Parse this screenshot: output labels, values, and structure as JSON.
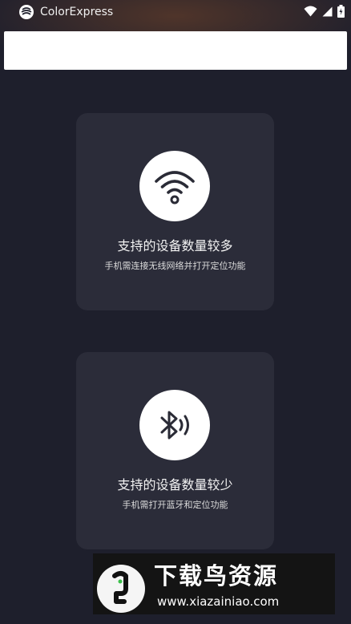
{
  "status_bar": {
    "app_name": "ColorExpress",
    "icons": [
      "app-logo-icon",
      "wifi-signal-icon",
      "cell-signal-icon",
      "battery-icon"
    ]
  },
  "search": {
    "value": "",
    "placeholder": ""
  },
  "cards": [
    {
      "icon": "wifi-icon",
      "title": "支持的设备数量较多",
      "subtitle": "手机需连接无线网络并打开定位功能"
    },
    {
      "icon": "bluetooth-icon",
      "title": "支持的设备数量较少",
      "subtitle": "手机需打开蓝牙和定位功能"
    }
  ],
  "watermark": {
    "title": "下载鸟资源",
    "url": "www.xiazainiao.com",
    "logo": "bird-logo-icon"
  },
  "colors": {
    "background": "#1e1f2c",
    "card": "#2b2c39",
    "icon_circle": "#ffffff",
    "icon_glyph": "#2a2b36"
  }
}
